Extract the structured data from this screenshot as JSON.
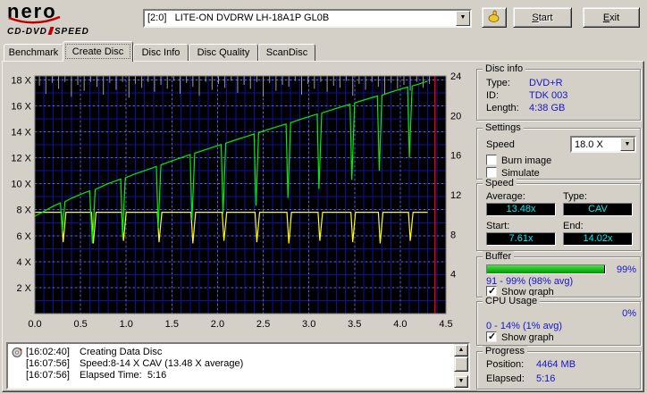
{
  "header": {
    "logo_main": "nero",
    "logo_sub1": "CD-DVD",
    "logo_sub2": "SPEED",
    "drive": "[2:0]   LITE-ON DVDRW LH-18A1P GL0B",
    "start_accel": "S",
    "start_rest": "tart",
    "exit_accel": "E",
    "exit_rest": "xit"
  },
  "tabs": [
    {
      "label": "Benchmark"
    },
    {
      "label": "Create Disc"
    },
    {
      "label": "Disc Info"
    },
    {
      "label": "Disc Quality"
    },
    {
      "label": "ScanDisc"
    }
  ],
  "disc_info": {
    "title": "Disc info",
    "type_label": "Type:",
    "type_value": "DVD+R",
    "id_label": "ID:",
    "id_value": "TDK 003",
    "length_label": "Length:",
    "length_value": "4:38 GB"
  },
  "settings": {
    "title": "Settings",
    "speed_label": "Speed",
    "speed_value": "18.0 X",
    "burn_image_label": "Burn image",
    "burn_image_checked": false,
    "simulate_label": "Simulate",
    "simulate_checked": false
  },
  "speed": {
    "title": "Speed",
    "average_label": "Average:",
    "average_value": "13.48x",
    "type_label": "Type:",
    "type_value": "CAV",
    "start_label": "Start:",
    "start_value": "7.61x",
    "end_label": "End:",
    "end_value": "14.02x"
  },
  "buffer": {
    "title": "Buffer",
    "value": "99%",
    "fill_percent": 99,
    "range": "91 - 99% (98% avg)",
    "show_graph_label": "Show graph",
    "show_graph_checked": true
  },
  "cpu": {
    "title": "CPU Usage",
    "value": "0%",
    "range": "0 - 14% (1% avg)",
    "show_graph_label": "Show graph",
    "show_graph_checked": true
  },
  "progress": {
    "title": "Progress",
    "position_label": "Position:",
    "position_value": "4464 MB",
    "elapsed_label": "Elapsed:",
    "elapsed_value": "5:16"
  },
  "log": [
    {
      "time": "[16:02:40]",
      "text": "Creating Data Disc"
    },
    {
      "time": "[16:07:56]",
      "text": "Speed:8-14 X CAV (13.48 X average)"
    },
    {
      "time": "[16:07:56]",
      "text": "Elapsed Time:  5:16"
    }
  ],
  "chart_data": {
    "type": "line",
    "title": "",
    "x_axis": {
      "labels": [
        "0.0",
        "0.5",
        "1.0",
        "1.5",
        "2.0",
        "2.5",
        "3.0",
        "3.5",
        "4.0",
        "4.5"
      ],
      "values": [
        0,
        0.5,
        1,
        1.5,
        2,
        2.5,
        3,
        3.5,
        4,
        4.5
      ],
      "range": [
        0,
        4.5
      ]
    },
    "left_axis": {
      "labels": [
        "18 X",
        "16 X",
        "14 X",
        "12 X",
        "10 X",
        "8 X",
        "6 X",
        "4 X",
        "2 X"
      ],
      "values": [
        18,
        16,
        14,
        12,
        10,
        8,
        6,
        4,
        2
      ],
      "range": [
        0,
        18.3
      ]
    },
    "right_axis": {
      "labels": [
        "24",
        "20",
        "16",
        "12",
        "8",
        "4"
      ],
      "values": [
        24,
        20,
        16,
        12,
        8,
        4
      ],
      "range": [
        0,
        24
      ]
    },
    "grid": {
      "fine_x_step": 0.1,
      "fine_y_step": 1,
      "grid_on": true,
      "legend": "none"
    },
    "colors": {
      "background": "#000000",
      "grid_fine": "#10109e",
      "grid_major": "#6f6f6f",
      "end_marker": "#dd0000"
    },
    "end_marker_x": 4.38,
    "series": [
      {
        "name": "buffer-level",
        "type": "spikes",
        "axis": "right",
        "color": "#9c9c9c",
        "spikes": [
          [
            0.05,
            1.0
          ],
          [
            0.12,
            1.8
          ],
          [
            0.19,
            0.7
          ],
          [
            0.26,
            1.3
          ],
          [
            0.33,
            0.6
          ],
          [
            0.4,
            2.1
          ],
          [
            0.47,
            0.9
          ],
          [
            0.54,
            1.5
          ],
          [
            0.61,
            0.6
          ],
          [
            0.68,
            1.1
          ],
          [
            0.75,
            1.9
          ],
          [
            0.82,
            0.7
          ],
          [
            0.89,
            1.4
          ],
          [
            0.96,
            0.6
          ],
          [
            1.03,
            2.2
          ],
          [
            1.1,
            0.8
          ],
          [
            1.17,
            1.2
          ],
          [
            1.24,
            0.6
          ],
          [
            1.31,
            1.6
          ],
          [
            1.38,
            0.9
          ],
          [
            1.45,
            1.3
          ],
          [
            1.52,
            0.5
          ],
          [
            1.59,
            1.8
          ],
          [
            1.66,
            0.7
          ],
          [
            1.73,
            1.1
          ],
          [
            1.8,
            2.0
          ],
          [
            1.87,
            0.6
          ],
          [
            1.94,
            1.4
          ],
          [
            2.01,
            0.8
          ],
          [
            2.08,
            1.2
          ],
          [
            2.15,
            0.5
          ],
          [
            2.22,
            1.7
          ],
          [
            2.29,
            0.9
          ],
          [
            2.36,
            1.3
          ],
          [
            2.43,
            0.6
          ],
          [
            2.5,
            2.1
          ],
          [
            2.57,
            0.7
          ],
          [
            2.64,
            1.5
          ],
          [
            2.71,
            0.9
          ],
          [
            2.78,
            1.1
          ],
          [
            2.85,
            0.5
          ],
          [
            2.92,
            1.9
          ],
          [
            2.99,
            0.8
          ],
          [
            3.06,
            1.3
          ],
          [
            3.13,
            0.6
          ],
          [
            3.2,
            1.6
          ],
          [
            3.27,
            1.0
          ],
          [
            3.34,
            1.2
          ],
          [
            3.41,
            0.5
          ],
          [
            3.48,
            2.0
          ],
          [
            3.55,
            0.8
          ],
          [
            3.62,
            1.4
          ],
          [
            3.69,
            0.6
          ],
          [
            3.76,
            1.1
          ],
          [
            3.83,
            1.8
          ],
          [
            3.9,
            0.7
          ],
          [
            3.97,
            1.3
          ],
          [
            4.04,
            0.9
          ],
          [
            4.11,
            1.5
          ],
          [
            4.18,
            0.6
          ],
          [
            4.25,
            1.2
          ],
          [
            4.32,
            0.8
          ]
        ]
      },
      {
        "name": "secondary-speed",
        "type": "line",
        "axis": "left",
        "color": "#ffff00",
        "points": [
          [
            0,
            7.8
          ],
          [
            0.29,
            7.8
          ],
          [
            0.31,
            5.5
          ],
          [
            0.34,
            7.8
          ],
          [
            0.62,
            7.8
          ],
          [
            0.64,
            5.4
          ],
          [
            0.67,
            7.8
          ],
          [
            0.95,
            7.8
          ],
          [
            0.97,
            5.6
          ],
          [
            1.0,
            7.8
          ],
          [
            1.34,
            7.8
          ],
          [
            1.36,
            5.5
          ],
          [
            1.39,
            7.8
          ],
          [
            1.71,
            7.8
          ],
          [
            1.73,
            5.4
          ],
          [
            1.76,
            7.8
          ],
          [
            2.05,
            7.8
          ],
          [
            2.07,
            5.6
          ],
          [
            2.1,
            7.8
          ],
          [
            2.41,
            7.8
          ],
          [
            2.43,
            5.5
          ],
          [
            2.46,
            7.8
          ],
          [
            2.76,
            7.8
          ],
          [
            2.78,
            5.4
          ],
          [
            2.81,
            7.8
          ],
          [
            3.1,
            7.8
          ],
          [
            3.12,
            5.6
          ],
          [
            3.15,
            7.8
          ],
          [
            3.46,
            7.8
          ],
          [
            3.48,
            5.5
          ],
          [
            3.51,
            7.8
          ],
          [
            3.76,
            7.8
          ],
          [
            3.78,
            5.4
          ],
          [
            3.81,
            7.8
          ],
          [
            4.09,
            7.8
          ],
          [
            4.11,
            5.6
          ],
          [
            4.14,
            7.8
          ],
          [
            4.3,
            7.8
          ]
        ]
      },
      {
        "name": "write-speed",
        "type": "line",
        "axis": "left",
        "color": "#00ee00",
        "points": [
          [
            0,
            7.5
          ],
          [
            0.1,
            7.88
          ],
          [
            0.2,
            8.27
          ],
          [
            0.28,
            8.52
          ],
          [
            0.3,
            6.3
          ],
          [
            0.33,
            8.62
          ],
          [
            0.4,
            8.88
          ],
          [
            0.5,
            9.18
          ],
          [
            0.6,
            9.45
          ],
          [
            0.63,
            5.4
          ],
          [
            0.66,
            9.55
          ],
          [
            0.8,
            10.0
          ],
          [
            0.94,
            10.36
          ],
          [
            0.96,
            5.9
          ],
          [
            0.99,
            10.45
          ],
          [
            1.1,
            10.76
          ],
          [
            1.2,
            11.0
          ],
          [
            1.33,
            11.33
          ],
          [
            1.35,
            6.6
          ],
          [
            1.38,
            11.45
          ],
          [
            1.5,
            11.76
          ],
          [
            1.6,
            12.0
          ],
          [
            1.7,
            12.24
          ],
          [
            1.72,
            7.2
          ],
          [
            1.75,
            12.35
          ],
          [
            1.9,
            12.7
          ],
          [
            2.04,
            13.02
          ],
          [
            2.06,
            7.7
          ],
          [
            2.09,
            13.12
          ],
          [
            2.2,
            13.38
          ],
          [
            2.3,
            13.6
          ],
          [
            2.4,
            13.83
          ],
          [
            2.42,
            8.3
          ],
          [
            2.45,
            13.93
          ],
          [
            2.6,
            14.28
          ],
          [
            2.75,
            14.6
          ],
          [
            2.77,
            8.9
          ],
          [
            2.8,
            14.7
          ],
          [
            2.9,
            14.94
          ],
          [
            3.0,
            15.16
          ],
          [
            3.09,
            15.36
          ],
          [
            3.11,
            9.6
          ],
          [
            3.14,
            15.44
          ],
          [
            3.3,
            15.8
          ],
          [
            3.45,
            16.12
          ],
          [
            3.47,
            10.3
          ],
          [
            3.5,
            16.22
          ],
          [
            3.6,
            16.44
          ],
          [
            3.75,
            16.76
          ],
          [
            3.77,
            11.0
          ],
          [
            3.8,
            16.82
          ],
          [
            3.9,
            17.07
          ],
          [
            4.0,
            17.28
          ],
          [
            4.08,
            17.45
          ],
          [
            4.1,
            12.0
          ],
          [
            4.13,
            17.52
          ],
          [
            4.2,
            17.67
          ],
          [
            4.3,
            17.9
          ]
        ]
      }
    ]
  }
}
